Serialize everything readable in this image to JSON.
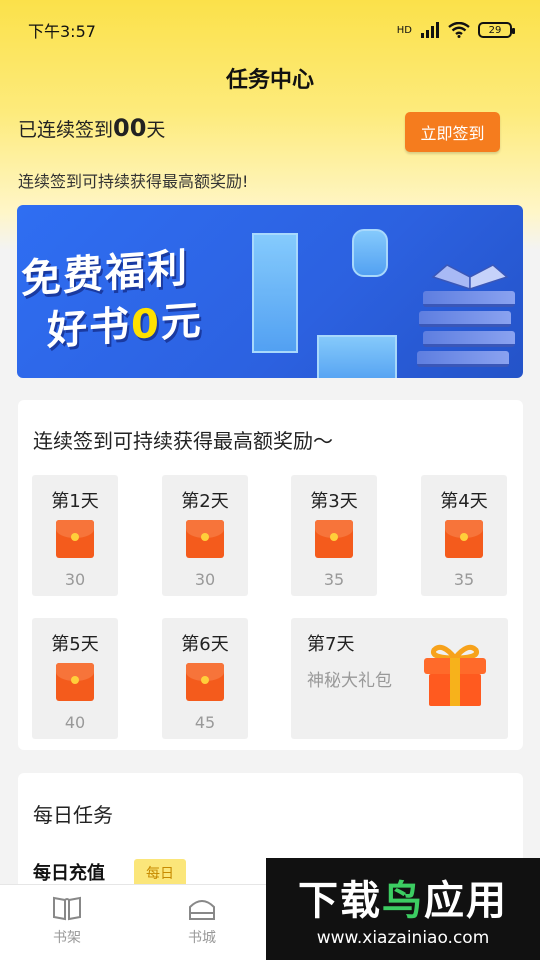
{
  "status_bar": {
    "time": "下午3:57",
    "network": "HD",
    "battery": "29"
  },
  "header": {
    "title": "任务中心",
    "signed_prefix": "已连续签到",
    "signed_days": "00",
    "signed_suffix": "天",
    "sign_button": "立即签到",
    "hint": "连续签到可持续获得最高额奖励!"
  },
  "banner": {
    "line1": "免费福利",
    "line2_prefix": "好书",
    "line2_zero": "0",
    "line2_suffix": "元"
  },
  "signin_card": {
    "title": "连续签到可持续获得最高额奖励～",
    "days": [
      {
        "label": "第1天",
        "reward": "30"
      },
      {
        "label": "第2天",
        "reward": "30"
      },
      {
        "label": "第3天",
        "reward": "35"
      },
      {
        "label": "第4天",
        "reward": "35"
      },
      {
        "label": "第5天",
        "reward": "40"
      },
      {
        "label": "第6天",
        "reward": "45"
      }
    ],
    "day7": {
      "label": "第7天",
      "sub": "神秘大礼包"
    }
  },
  "daily_tasks": {
    "title": "每日任务",
    "row_label": "每日充值",
    "row_badge": "每日"
  },
  "tabbar": {
    "items": [
      {
        "label": "书架",
        "icon": "book-icon"
      },
      {
        "label": "书城",
        "icon": "store-icon"
      }
    ]
  },
  "watermark": {
    "title_prefix": "下载",
    "title_mid": "鸟",
    "title_suffix": "应用",
    "url": "www.xiazainiao.com"
  },
  "colors": {
    "header_yellow": "#fbe14a",
    "sign_button": "#f57c1e",
    "banner_blue": "#2f6ef2",
    "envelope": "#f45b1c",
    "watermark_green": "#3ccd62"
  }
}
